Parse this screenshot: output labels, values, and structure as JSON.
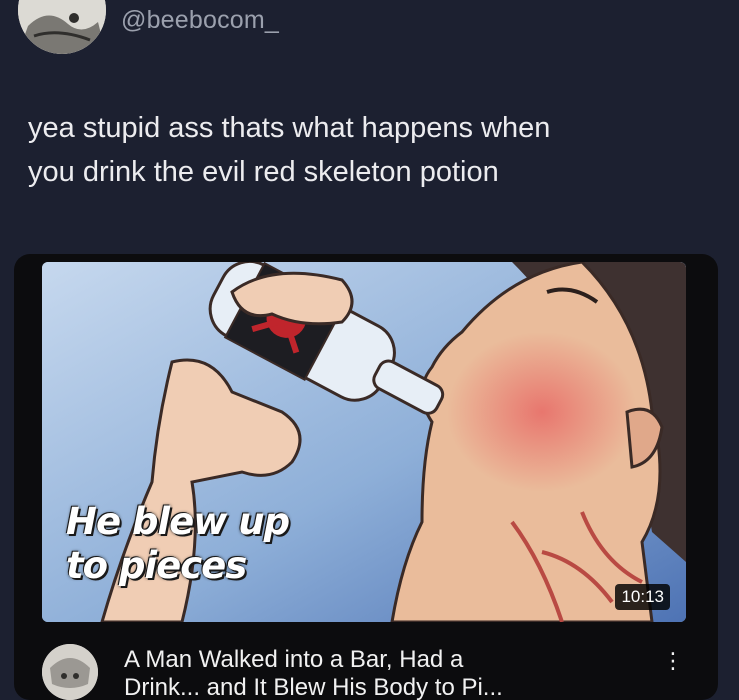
{
  "post": {
    "handle": "@beebocom_",
    "text_line1": "yea stupid ass thats what happens when",
    "text_line2": "you drink the evil red skeleton potion"
  },
  "video": {
    "caption_line1": "He blew up",
    "caption_line2": "to pieces",
    "duration": "10:13",
    "title_line1": "A Man Walked into a Bar, Had a",
    "title_line2": "Drink... and It Blew His Body to Pi..."
  },
  "icons": {
    "more": "more-vertical-icon",
    "skull": "skull-crossbones-icon"
  },
  "colors": {
    "background": "#1c2030",
    "card": "#0c0c0e",
    "handle": "#9ba0ad",
    "text": "#ececef",
    "label_red": "#c0252c"
  }
}
